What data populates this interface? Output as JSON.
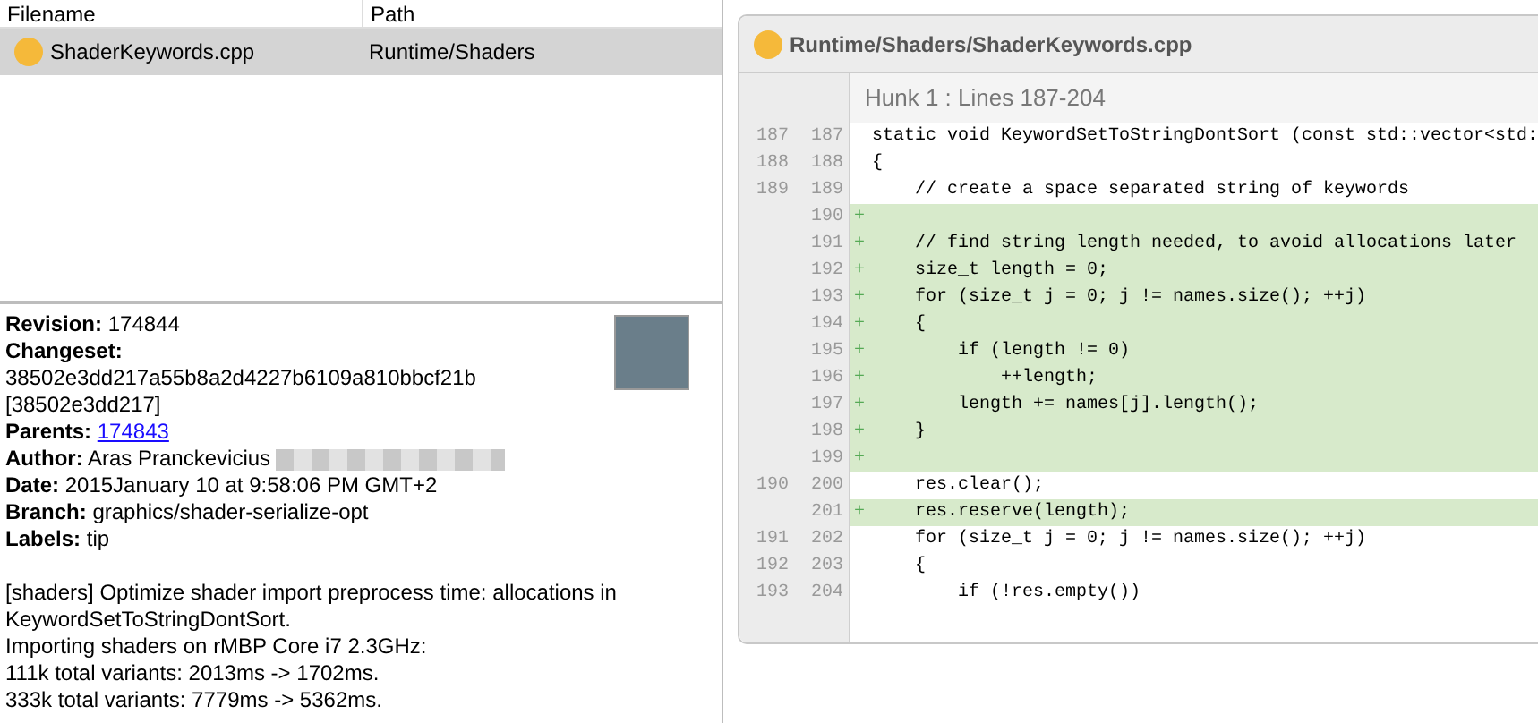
{
  "file_list": {
    "columns": [
      "Filename",
      "Path"
    ],
    "rows": [
      {
        "filename": "ShaderKeywords.cpp",
        "path": "Runtime/Shaders",
        "selected": true
      }
    ]
  },
  "details": {
    "fields": [
      {
        "kind": "text",
        "label": "Revision:",
        "value": "174844"
      },
      {
        "kind": "heading",
        "label": "Changeset:"
      },
      {
        "kind": "plain",
        "value": "38502e3dd217a55b8a2d4227b6109a810bbcf21b"
      },
      {
        "kind": "plain",
        "value": "[38502e3dd217]"
      },
      {
        "kind": "link",
        "label": "Parents:",
        "value": "174843"
      },
      {
        "kind": "redacted",
        "label": "Author:",
        "value": "Aras Pranckevicius"
      },
      {
        "kind": "text",
        "label": "Date:",
        "value": "2015January 10 at 9:58:06 PM GMT+2"
      },
      {
        "kind": "text",
        "label": "Branch:",
        "value": "graphics/shader-serialize-opt"
      },
      {
        "kind": "text",
        "label": "Labels:",
        "value": "tip"
      }
    ],
    "message": [
      "[shaders] Optimize shader import preprocess time: allocations in KeywordSetToStringDontSort.",
      "Importing shaders on rMBP Core i7 2.3GHz:",
      "111k total variants: 2013ms -> 1702ms.",
      "333k total variants: 7779ms -> 5362ms."
    ]
  },
  "diff": {
    "title": "Runtime/Shaders/ShaderKeywords.cpp",
    "hunk": "Hunk 1 : Lines 187-204",
    "lines": [
      {
        "kind": "context",
        "old": "187",
        "new": "187",
        "code": "static void KeywordSetToStringDontSort (const std::vector<std:"
      },
      {
        "kind": "context",
        "old": "188",
        "new": "188",
        "code": "{"
      },
      {
        "kind": "context",
        "old": "189",
        "new": "189",
        "code": "    // create a space separated string of keywords"
      },
      {
        "kind": "added",
        "new": "190",
        "marker": "+"
      },
      {
        "kind": "added",
        "new": "191",
        "marker": "+",
        "code": "    // find string length needed, to avoid allocations later"
      },
      {
        "kind": "added",
        "new": "192",
        "marker": "+",
        "code": "    size_t length = 0;"
      },
      {
        "kind": "added",
        "new": "193",
        "marker": "+",
        "code": "    for (size_t j = 0; j != names.size(); ++j)"
      },
      {
        "kind": "added",
        "new": "194",
        "marker": "+",
        "code": "    {"
      },
      {
        "kind": "added",
        "new": "195",
        "marker": "+",
        "code": "        if (length != 0)"
      },
      {
        "kind": "added",
        "new": "196",
        "marker": "+",
        "code": "            ++length;"
      },
      {
        "kind": "added",
        "new": "197",
        "marker": "+",
        "code": "        length += names[j].length();"
      },
      {
        "kind": "added",
        "new": "198",
        "marker": "+",
        "code": "    }"
      },
      {
        "kind": "added",
        "new": "199",
        "marker": "+"
      },
      {
        "kind": "context",
        "old": "190",
        "new": "200",
        "code": "    res.clear();"
      },
      {
        "kind": "added",
        "new": "201",
        "marker": "+",
        "code": "    res.reserve(length);"
      },
      {
        "kind": "context",
        "old": "191",
        "new": "202",
        "code": "    for (size_t j = 0; j != names.size(); ++j)"
      },
      {
        "kind": "context",
        "old": "192",
        "new": "203",
        "code": "    {"
      },
      {
        "kind": "context",
        "old": "193",
        "new": "204",
        "code": "        if (!res.empty())"
      }
    ]
  }
}
